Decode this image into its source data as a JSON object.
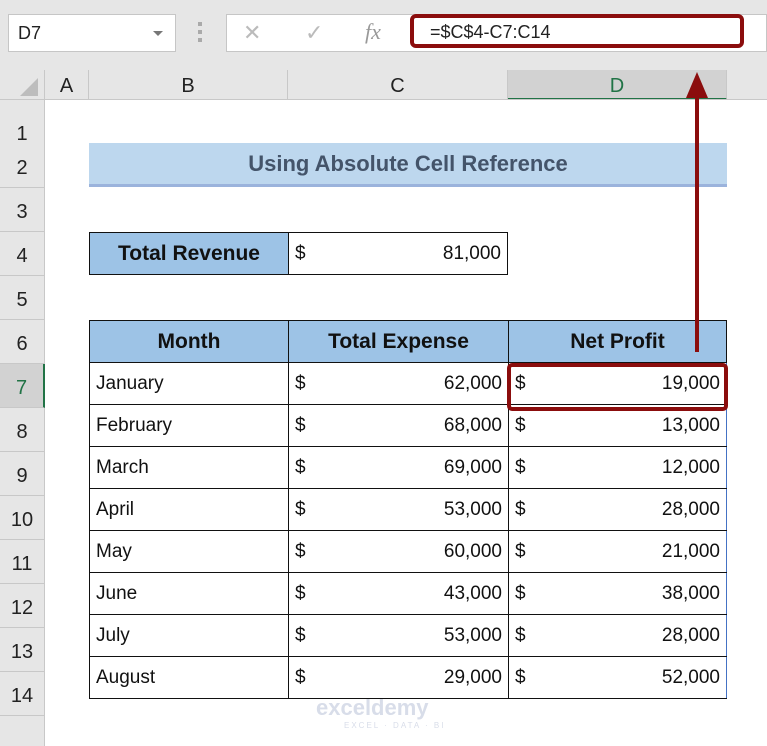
{
  "formula_bar": {
    "name_box": "D7",
    "formula": "=$C$4-C7:C14",
    "cancel_icon": "✕",
    "enter_icon": "✓",
    "fx_icon": "fx"
  },
  "columns": [
    "A",
    "B",
    "C",
    "D"
  ],
  "selected_column": "D",
  "rows": [
    "1",
    "2",
    "3",
    "4",
    "5",
    "6",
    "7",
    "8",
    "9",
    "10",
    "11",
    "12",
    "13",
    "14"
  ],
  "selected_row": "7",
  "title": "Using Absolute Cell Reference",
  "revenue": {
    "label": "Total Revenue",
    "currency": "$",
    "value": "81,000"
  },
  "table": {
    "headers": [
      "Month",
      "Total Expense",
      "Net Profit"
    ],
    "rows": [
      {
        "month": "January",
        "expense": "62,000",
        "profit": "19,000"
      },
      {
        "month": "February",
        "expense": "68,000",
        "profit": "13,000"
      },
      {
        "month": "March",
        "expense": "69,000",
        "profit": "12,000"
      },
      {
        "month": "April",
        "expense": "53,000",
        "profit": "28,000"
      },
      {
        "month": "May",
        "expense": "60,000",
        "profit": "21,000"
      },
      {
        "month": "June",
        "expense": "43,000",
        "profit": "38,000"
      },
      {
        "month": "July",
        "expense": "53,000",
        "profit": "28,000"
      },
      {
        "month": "August",
        "expense": "29,000",
        "profit": "52,000"
      }
    ],
    "currency": "$"
  },
  "watermark": {
    "name": "exceldemy",
    "tagline": "EXCEL · DATA · BI"
  },
  "colors": {
    "highlight": "#8b0d0d",
    "header_fill": "#9dc3e6",
    "title_fill": "#bdd7ee",
    "selection": "#217346"
  }
}
